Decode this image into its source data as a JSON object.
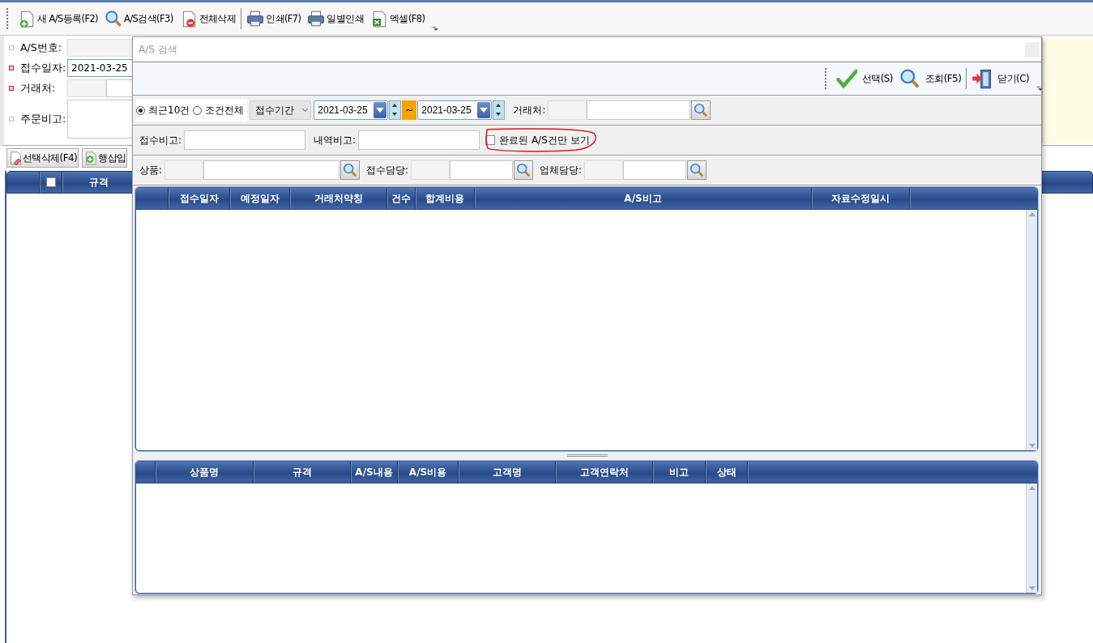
{
  "app": {
    "toolbar": [
      {
        "label": "새 A/S등록(F2)",
        "kind": "new"
      },
      {
        "label": "A/S검색(F3)",
        "kind": "search"
      },
      {
        "label": "전체삭제",
        "kind": "delete"
      },
      {
        "label": "인쇄(F7)",
        "kind": "print",
        "separator": true
      },
      {
        "label": "일별인쇄",
        "kind": "print"
      },
      {
        "label": "엑셀(F8)",
        "kind": "excel"
      }
    ],
    "form": [
      {
        "label": "A/S번호:",
        "required": false,
        "kind": "text"
      },
      {
        "label": "접수일자:",
        "required": true,
        "kind": "date",
        "value": "2021-03-25"
      },
      {
        "label": "거래처:",
        "required": true,
        "kind": "lookup"
      },
      {
        "label": "주문비고:",
        "required": false,
        "kind": "memo"
      }
    ],
    "row_buttons": [
      {
        "label": "선택삭제(F4)",
        "kind": "erase"
      },
      {
        "label": "행삽입",
        "kind": "add"
      }
    ],
    "grid": {
      "select_all_checked": false,
      "columns": [
        "규격"
      ]
    }
  },
  "dialog": {
    "title": "A/S 검색",
    "toolbar": [
      {
        "label": "선택(S)",
        "kind": "check"
      },
      {
        "label": "조회(F5)",
        "kind": "search"
      },
      {
        "label": "닫기(C)",
        "kind": "exit",
        "separator": true
      }
    ],
    "modes": [
      {
        "label": "최근10건",
        "selected": true
      },
      {
        "label": "조건전체",
        "selected": false
      }
    ],
    "period": {
      "value": "접수기간",
      "from": "2021-03-25",
      "separator": "~",
      "to": "2021-03-25"
    },
    "customer_label": "거래처:",
    "memo_fields": [
      {
        "label": "접수비고:"
      },
      {
        "label": "내역비고:"
      }
    ],
    "completed_only": {
      "label": "완료된 A/S건만 보기",
      "checked": false,
      "highlighted": true
    },
    "lookups": [
      {
        "label": "상품:"
      },
      {
        "label": "접수담당:"
      },
      {
        "label": "업체담당:"
      }
    ],
    "grid_top": {
      "columns": [
        "접수일자",
        "예정일자",
        "거래처약칭",
        "건수",
        "합계비용",
        "A/S비고",
        "자료수정일시"
      ]
    },
    "grid_bottom": {
      "columns": [
        "상품명",
        "규격",
        "A/S내용",
        "A/S비용",
        "고객명",
        "고객연락처",
        "비고",
        "상태"
      ]
    }
  }
}
